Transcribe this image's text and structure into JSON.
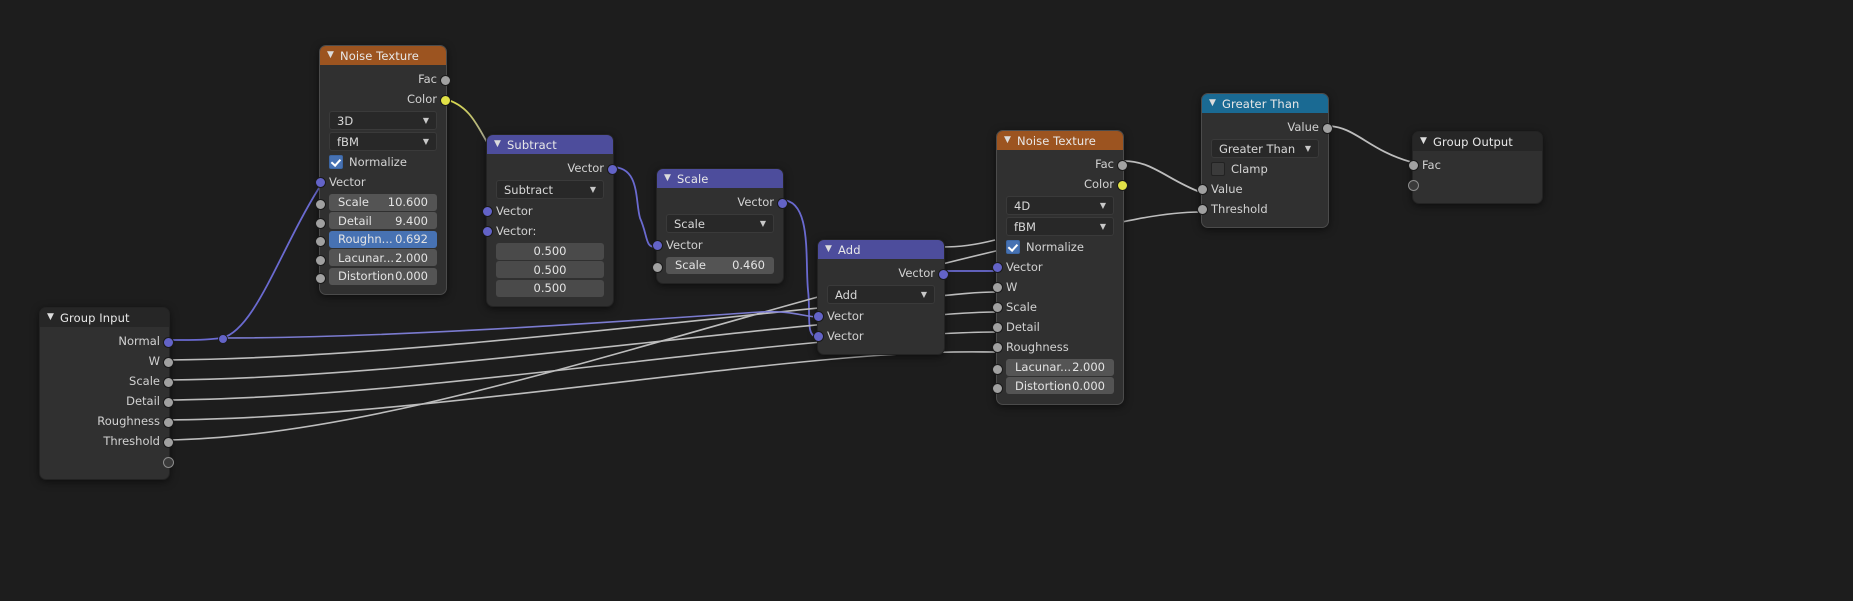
{
  "app": {
    "editor": "blender-node-editor",
    "background": "#1d1d1d"
  },
  "colors": {
    "header_texture": "#9c5420",
    "header_vector": "#4d4d9c",
    "header_converter": "#1a6a93",
    "header_group": "#262626",
    "socket_vector": "#6363c7",
    "socket_value": "#a1a1a1",
    "socket_color": "#e1e147",
    "node_body": "#303030",
    "field_blue": "#4772b3"
  },
  "nodes": {
    "group_input": {
      "title": "Group Input",
      "outputs": [
        "Normal",
        "W",
        "Scale",
        "Detail",
        "Roughness",
        "Threshold",
        ""
      ]
    },
    "noise_texture_1": {
      "title": "Noise Texture",
      "outputs": [
        "Fac",
        "Color"
      ],
      "dimension": "3D",
      "noise_type": "fBM",
      "normalize_label": "Normalize",
      "normalize_checked": true,
      "vector_label": "Vector",
      "fields": [
        {
          "label": "Scale",
          "value": "10.600",
          "highlight": false
        },
        {
          "label": "Detail",
          "value": "9.400",
          "highlight": false
        },
        {
          "label": "Roughn...",
          "value": "0.692",
          "highlight": true
        },
        {
          "label": "Lacunar...",
          "value": "2.000",
          "highlight": false
        },
        {
          "label": "Distortion",
          "value": "0.000",
          "highlight": false
        }
      ]
    },
    "subtract": {
      "title": "Subtract",
      "outputs": [
        "Vector"
      ],
      "operation": "Subtract",
      "inputs": [
        "Vector",
        "Vector:"
      ],
      "values": [
        "0.500",
        "0.500",
        "0.500"
      ]
    },
    "scale": {
      "title": "Scale",
      "outputs": [
        "Vector"
      ],
      "operation": "Scale",
      "inputs": [
        "Vector"
      ],
      "fields": [
        {
          "label": "Scale",
          "value": "0.460"
        }
      ]
    },
    "add": {
      "title": "Add",
      "outputs": [
        "Vector"
      ],
      "operation": "Add",
      "inputs": [
        "Vector",
        "Vector"
      ]
    },
    "noise_texture_2": {
      "title": "Noise Texture",
      "outputs": [
        "Fac",
        "Color"
      ],
      "dimension": "4D",
      "noise_type": "fBM",
      "normalize_label": "Normalize",
      "normalize_checked": true,
      "inputs": [
        "Vector",
        "W",
        "Scale",
        "Detail",
        "Roughness"
      ],
      "fields": [
        {
          "label": "Lacunar...",
          "value": "2.000"
        },
        {
          "label": "Distortion",
          "value": "0.000"
        }
      ]
    },
    "greater_than": {
      "title": "Greater Than",
      "outputs": [
        "Value"
      ],
      "operation": "Greater Than",
      "clamp_label": "Clamp",
      "clamp_checked": false,
      "inputs": [
        "Value",
        "Threshold"
      ]
    },
    "group_output": {
      "title": "Group Output",
      "inputs": [
        "Fac",
        ""
      ]
    }
  },
  "icons": {
    "collapse": "chevron-down-icon",
    "dropdown": "chevron-down-icon"
  }
}
